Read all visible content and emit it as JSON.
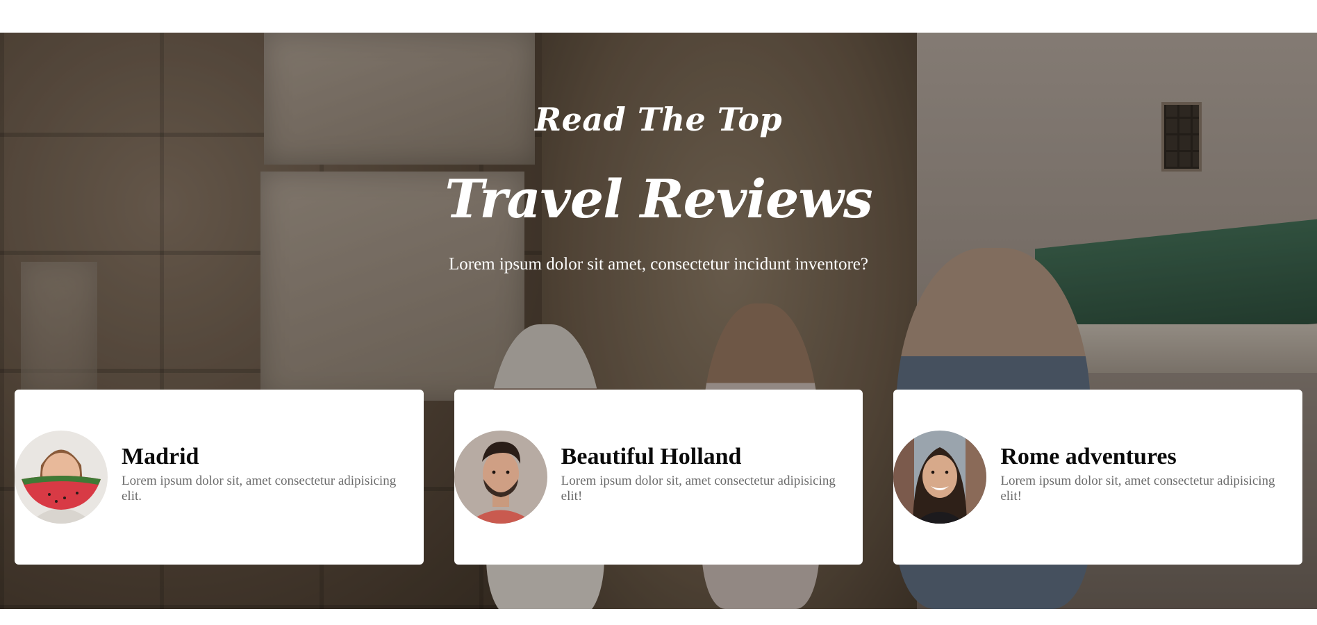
{
  "hero": {
    "heading_small": "Read The Top",
    "heading_script": "Travel Reviews",
    "subtitle": "Lorem ipsum dolor sit amet, consectetur incidunt inventore?"
  },
  "reviews": [
    {
      "title": "Madrid",
      "text": "Lorem ipsum dolor sit, amet consectetur adipisicing elit.",
      "avatar_icon": "woman-with-watermelon-photo"
    },
    {
      "title": "Beautiful Holland",
      "text": "Lorem ipsum dolor sit, amet consectetur adipisicing elit!",
      "avatar_icon": "bearded-man-photo"
    },
    {
      "title": "Rome adventures",
      "text": "Lorem ipsum dolor sit, amet consectetur adipisicing elit!",
      "avatar_icon": "smiling-woman-photo"
    }
  ],
  "colors": {
    "card_background": "#ffffff",
    "card_title": "#0a0a0a",
    "card_text": "#6b6b6b",
    "hero_text": "#ffffff"
  }
}
